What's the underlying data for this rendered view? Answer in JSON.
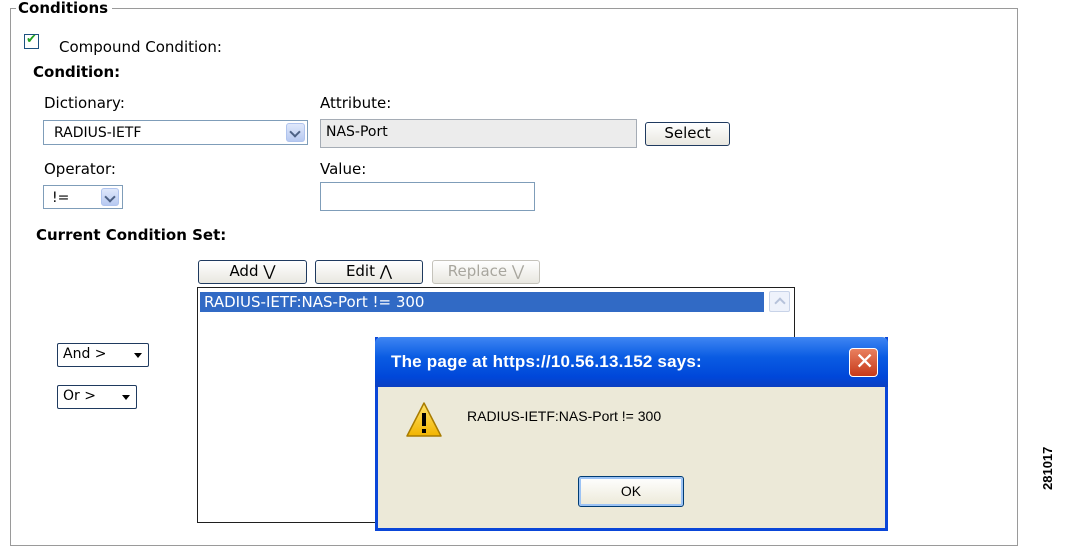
{
  "fieldset": {
    "legend": "Conditions"
  },
  "compound": {
    "checked": true,
    "label": "Compound Condition:"
  },
  "condition": {
    "heading": "Condition:",
    "dictionary_label": "Dictionary:",
    "dictionary_value": "RADIUS-IETF",
    "attribute_label": "Attribute:",
    "attribute_value": "NAS-Port",
    "select_button": "Select",
    "operator_label": "Operator:",
    "operator_value": "!=",
    "value_label": "Value:",
    "value_value": ""
  },
  "condition_set": {
    "heading": "Current Condition Set:",
    "add_button": "Add ⋁",
    "edit_button": "Edit ⋀",
    "replace_button": "Replace ⋁",
    "items": [
      "RADIUS-IETF:NAS-Port != 300"
    ],
    "and_select": "And >",
    "or_select": "Or >"
  },
  "dialog": {
    "title": "The page at https://10.56.13.152 says:",
    "message": "RADIUS-IETF:NAS-Port != 300",
    "ok_button": "OK",
    "close_glyph": "✕"
  },
  "side_label": "281017",
  "colors": {
    "selection": "#316ac5",
    "titlebar": "#0a5ce3",
    "check": "#21a121"
  },
  "icons": [
    "checkmark-icon",
    "chevron-down-icon",
    "chevron-up-icon",
    "close-icon",
    "warning-icon"
  ]
}
